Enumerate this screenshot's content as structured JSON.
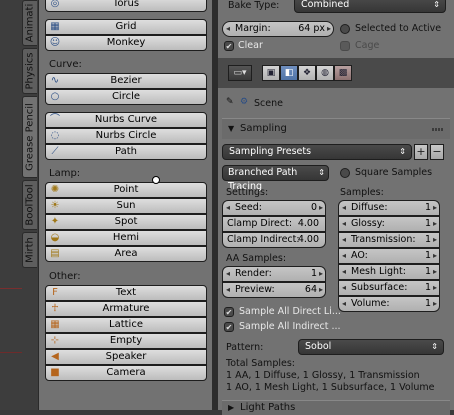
{
  "tabs": [
    {
      "label": "Animati",
      "active": false
    },
    {
      "label": "Physics",
      "active": false
    },
    {
      "label": "Grease Pencil",
      "active": true
    },
    {
      "label": "BoolTool",
      "active": false
    },
    {
      "label": "Mirth",
      "active": false
    }
  ],
  "tools": {
    "mesh_items": [
      {
        "label": "Torus",
        "icon": "torus-icon"
      },
      {
        "label": "Grid",
        "icon": "grid-icon"
      },
      {
        "label": "Monkey",
        "icon": "monkey-icon"
      }
    ],
    "curve_label": "Curve:",
    "curve_items": [
      {
        "label": "Bezier",
        "icon": "bezier-icon"
      },
      {
        "label": "Circle",
        "icon": "circle-curve-icon"
      },
      {
        "label": "Nurbs Curve",
        "icon": "nurbs-curve-icon"
      },
      {
        "label": "Nurbs Circle",
        "icon": "nurbs-circle-icon"
      },
      {
        "label": "Path",
        "icon": "path-icon"
      }
    ],
    "lamp_label": "Lamp:",
    "lamp_items": [
      {
        "label": "Point",
        "icon": "point-lamp-icon"
      },
      {
        "label": "Sun",
        "icon": "sun-lamp-icon"
      },
      {
        "label": "Spot",
        "icon": "spot-lamp-icon"
      },
      {
        "label": "Hemi",
        "icon": "hemi-lamp-icon"
      },
      {
        "label": "Area",
        "icon": "area-lamp-icon"
      }
    ],
    "other_label": "Other:",
    "other_items": [
      {
        "label": "Text",
        "icon": "text-icon"
      },
      {
        "label": "Armature",
        "icon": "armature-icon"
      },
      {
        "label": "Lattice",
        "icon": "lattice-icon"
      },
      {
        "label": "Empty",
        "icon": "empty-icon"
      },
      {
        "label": "Speaker",
        "icon": "speaker-icon"
      },
      {
        "label": "Camera",
        "icon": "camera-icon"
      }
    ]
  },
  "bake": {
    "type_label": "Bake Type:",
    "type_value": "Combined",
    "margin_label": "Margin:",
    "margin_value": "64 px",
    "selected_to_active": "Selected to Active",
    "clear": "Clear",
    "cage": "Cage"
  },
  "breadcrumb": "Scene",
  "sampling": {
    "header": "Sampling",
    "presets": "Sampling Presets",
    "integrator": "Branched Path Tracing",
    "square_samples": "Square Samples",
    "settings_label": "Settings:",
    "samples_label": "Samples:",
    "settings": [
      {
        "label": "Seed:",
        "value": "0"
      },
      {
        "label": "Clamp Direct:",
        "value": "4.00"
      },
      {
        "label": "Clamp Indirect:",
        "value": "4.00"
      }
    ],
    "samples": [
      {
        "label": "Diffuse:",
        "value": "1"
      },
      {
        "label": "Glossy:",
        "value": "1"
      },
      {
        "label": "Transmission:",
        "value": "1"
      },
      {
        "label": "AO:",
        "value": "1"
      },
      {
        "label": "Mesh Light:",
        "value": "1"
      },
      {
        "label": "Subsurface:",
        "value": "1"
      },
      {
        "label": "Volume:",
        "value": "1"
      }
    ],
    "aa_label": "AA Samples:",
    "aa": [
      {
        "label": "Render:",
        "value": "1"
      },
      {
        "label": "Preview:",
        "value": "64"
      }
    ],
    "sample_all_direct": "Sample All Direct Li...",
    "sample_all_indirect": "Sample All Indirect ...",
    "pattern_label": "Pattern:",
    "pattern_value": "Sobol",
    "total_label": "Total Samples:",
    "total_line1": "1 AA, 1 Diffuse, 1 Glossy, 1 Transmission",
    "total_line2": "1 AO, 1 Mesh Light, 1 Subsurface, 1 Volume"
  },
  "light_paths_header": "Light Paths"
}
